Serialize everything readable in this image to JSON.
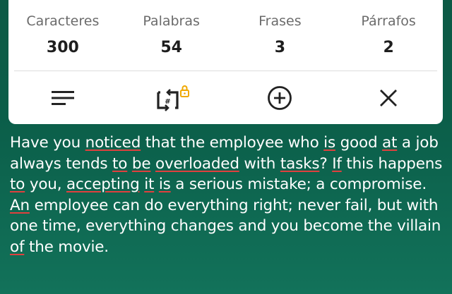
{
  "stats": [
    {
      "label": "Caracteres",
      "value": "300"
    },
    {
      "label": "Palabras",
      "value": "54"
    },
    {
      "label": "Frases",
      "value": "3"
    },
    {
      "label": "Párrafos",
      "value": "2"
    }
  ],
  "toolbar": {
    "icons": [
      "menu-icon",
      "sync-locked-icon",
      "add-circle-icon",
      "close-icon"
    ],
    "lock_color": "#f0a800"
  },
  "text": {
    "tokens": [
      {
        "t": "Have you "
      },
      {
        "t": "noticed",
        "m": true
      },
      {
        "t": " that the employee who "
      },
      {
        "t": "is",
        "m": true
      },
      {
        "t": " good "
      },
      {
        "t": "at",
        "m": true
      },
      {
        "t": " a job always tends "
      },
      {
        "t": "to",
        "m": true
      },
      {
        "t": " "
      },
      {
        "t": "be",
        "m": true
      },
      {
        "t": " "
      },
      {
        "t": "overloaded",
        "m": true
      },
      {
        "t": " with "
      },
      {
        "t": "tasks",
        "m": true
      },
      {
        "t": "? "
      },
      {
        "t": "If",
        "m": true
      },
      {
        "t": " this happens "
      },
      {
        "t": "to",
        "m": true
      },
      {
        "t": " you, "
      },
      {
        "t": "accepting",
        "m": true
      },
      {
        "t": " "
      },
      {
        "t": "it",
        "m": true
      },
      {
        "t": " "
      },
      {
        "t": "is",
        "m": true
      },
      {
        "t": " a serious mistake; a compromise. "
      },
      {
        "t": "An",
        "m": true
      },
      {
        "t": " employee can do everything right; never fail, but with one time, everything changes and you become the villain "
      },
      {
        "t": "of",
        "m": true
      },
      {
        "t": " the movie."
      }
    ]
  }
}
